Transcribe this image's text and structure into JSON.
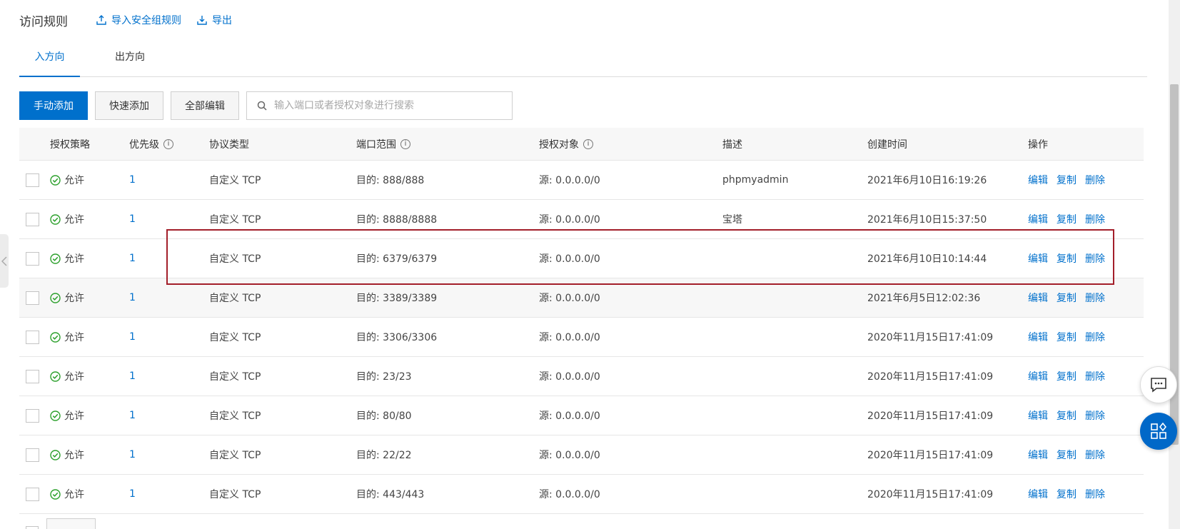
{
  "header": {
    "title": "访问规则",
    "import_label": "导入安全组规则",
    "export_label": "导出"
  },
  "tabs": [
    {
      "label": "入方向",
      "active": true
    },
    {
      "label": "出方向",
      "active": false
    }
  ],
  "toolbar": {
    "manual_add": "手动添加",
    "quick_add": "快速添加",
    "edit_all": "全部编辑",
    "search_placeholder": "输入端口或者授权对象进行搜索"
  },
  "columns": {
    "policy": "授权策略",
    "priority": "优先级",
    "protocol": "协议类型",
    "port": "端口范围",
    "auth": "授权对象",
    "desc": "描述",
    "time": "创建时间",
    "ops": "操作"
  },
  "ops": {
    "edit": "编辑",
    "copy": "复制",
    "delete": "删除"
  },
  "rows": [
    {
      "policy": "允许",
      "priority": "1",
      "protocol": "自定义 TCP",
      "port": "目的: 888/888",
      "auth": "源: 0.0.0.0/0",
      "desc": "phpmyadmin",
      "time": "2021年6月10日16:19:26"
    },
    {
      "policy": "允许",
      "priority": "1",
      "protocol": "自定义 TCP",
      "port": "目的: 8888/8888",
      "auth": "源: 0.0.0.0/0",
      "desc": "宝塔",
      "time": "2021年6月10日15:37:50"
    },
    {
      "policy": "允许",
      "priority": "1",
      "protocol": "自定义 TCP",
      "port": "目的: 6379/6379",
      "auth": "源: 0.0.0.0/0",
      "desc": "",
      "time": "2021年6月10日10:14:44"
    },
    {
      "policy": "允许",
      "priority": "1",
      "protocol": "自定义 TCP",
      "port": "目的: 3389/3389",
      "auth": "源: 0.0.0.0/0",
      "desc": "",
      "time": "2021年6月5日12:02:36"
    },
    {
      "policy": "允许",
      "priority": "1",
      "protocol": "自定义 TCP",
      "port": "目的: 3306/3306",
      "auth": "源: 0.0.0.0/0",
      "desc": "",
      "time": "2020年11月15日17:41:09"
    },
    {
      "policy": "允许",
      "priority": "1",
      "protocol": "自定义 TCP",
      "port": "目的: 23/23",
      "auth": "源: 0.0.0.0/0",
      "desc": "",
      "time": "2020年11月15日17:41:09"
    },
    {
      "policy": "允许",
      "priority": "1",
      "protocol": "自定义 TCP",
      "port": "目的: 80/80",
      "auth": "源: 0.0.0.0/0",
      "desc": "",
      "time": "2020年11月15日17:41:09"
    },
    {
      "policy": "允许",
      "priority": "1",
      "protocol": "自定义 TCP",
      "port": "目的: 22/22",
      "auth": "源: 0.0.0.0/0",
      "desc": "",
      "time": "2020年11月15日17:41:09"
    },
    {
      "policy": "允许",
      "priority": "1",
      "protocol": "自定义 TCP",
      "port": "目的: 443/443",
      "auth": "源: 0.0.0.0/0",
      "desc": "",
      "time": "2020年11月15日17:41:09"
    }
  ],
  "colors": {
    "accent": "#0070cc",
    "success": "#2ca02c",
    "highlight_border": "#a31f2a"
  },
  "icons": {
    "import": "upload-icon",
    "export": "download-icon",
    "search": "search-icon",
    "info": "info-icon",
    "status": "check-circle-icon",
    "chat": "chat-icon",
    "apps": "apps-icon"
  }
}
